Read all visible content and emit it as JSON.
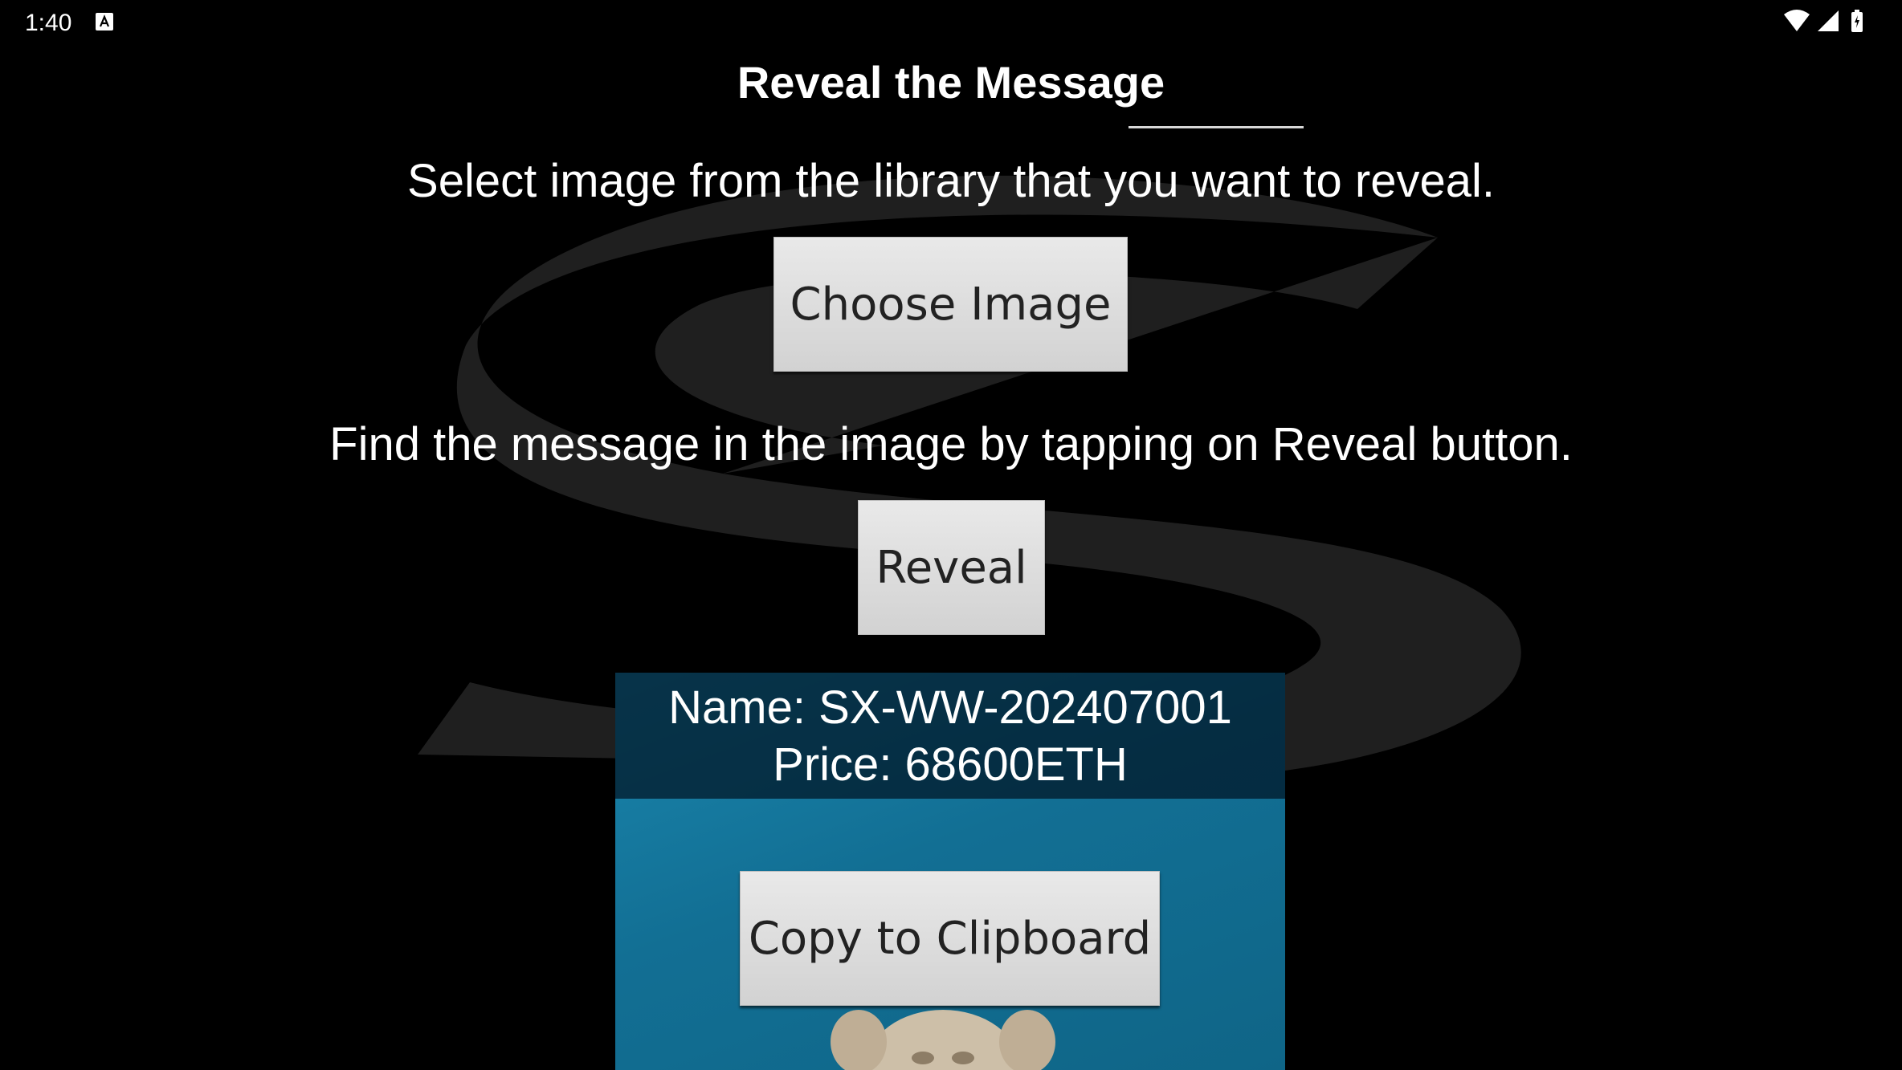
{
  "status_bar": {
    "time": "1:40",
    "notification_icon": "a-icon",
    "icons": [
      "wifi-icon",
      "cell-signal-icon",
      "battery-icon"
    ]
  },
  "page": {
    "title": "Reveal the Message",
    "instruction_select": "Select image from the library that you want to reveal.",
    "choose_button_label": "Choose Image",
    "instruction_reveal": "Find the message in the image by tapping on Reveal button.",
    "reveal_button_label": "Reveal"
  },
  "image_preview": {
    "name_line": "Name: SX-WW-202407001",
    "price_line": "Price: 68600ETH",
    "copy_button_label": "Copy to Clipboard"
  },
  "colors": {
    "background": "#000000",
    "logo_watermark": "#1e1e1e",
    "button_face": "#dcdcdc",
    "image_background": "#1a86ad"
  }
}
